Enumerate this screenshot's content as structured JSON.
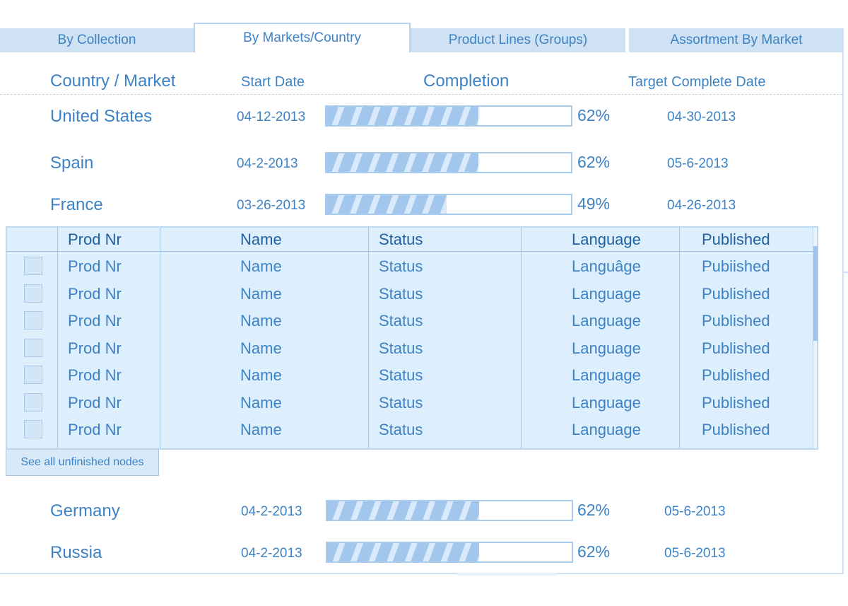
{
  "tabs": [
    {
      "label": "By Collection",
      "active": false
    },
    {
      "label": "By Markets/Country",
      "active": true
    },
    {
      "label": "Product Lines (Groups)",
      "active": false
    },
    {
      "label": "Assortment By Market",
      "active": false
    }
  ],
  "header": {
    "country": "Country / Market",
    "start": "Start Date",
    "completion": "Completion",
    "target": "Target Complete Date"
  },
  "markets": [
    {
      "name": "United States",
      "start": "04-12-2013",
      "completion": 62,
      "pct_label": "62%",
      "target": "04-30-2013"
    },
    {
      "name": "Spain",
      "start": "04-2-2013",
      "completion": 62,
      "pct_label": "62%",
      "target": "05-6-2013"
    },
    {
      "name": "France",
      "start": "03-26-2013",
      "completion": 49,
      "pct_label": "49%",
      "target": "04-26-2013"
    },
    {
      "name": "Germany",
      "start": "04-2-2013",
      "completion": 62,
      "pct_label": "62%",
      "target": "05-6-2013"
    },
    {
      "name": "Russia",
      "start": "04-2-2013",
      "completion": 62,
      "pct_label": "62%",
      "target": "05-6-2013"
    }
  ],
  "table": {
    "columns": [
      "Prod Nr",
      "Name",
      "Status",
      "Language",
      "Published"
    ],
    "rows": [
      [
        "Prod Nr",
        "Name",
        "Status",
        "Languâge",
        "Pubiished"
      ],
      [
        "Prod Nr",
        "Name",
        "Status",
        "Language",
        "Published"
      ],
      [
        "Prod Nr",
        "Name",
        "Status",
        "Language",
        "Published"
      ],
      [
        "Prod Nr",
        "Name",
        "Status",
        "Language",
        "Published"
      ],
      [
        "Prod Nr",
        "Name",
        "Status",
        "Language",
        "Published"
      ],
      [
        "Prod Nr",
        "Name",
        "Status",
        "Language",
        "Published"
      ],
      [
        "Prod Nr",
        "Name",
        "Status",
        "Language",
        "Published"
      ]
    ],
    "see_all": "See all unfinished nodes"
  },
  "colors": {
    "accent": "#3d82c4",
    "tab_bg": "#cfe2f3",
    "table_bg": "#ddeefc",
    "bar_fill": "#a3c7ec"
  }
}
